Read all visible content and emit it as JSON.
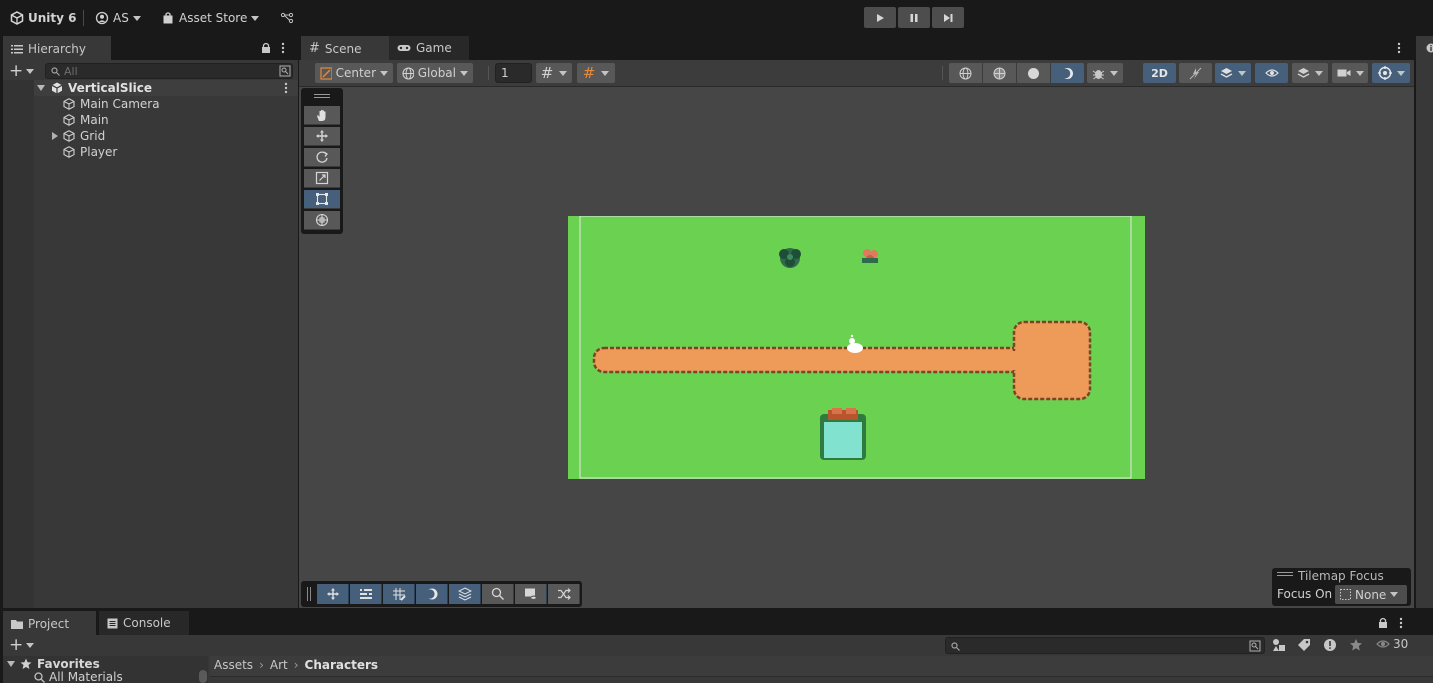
{
  "topbar": {
    "app_label": "Unity 6",
    "account_label": "AS",
    "asset_store_label": "Asset Store"
  },
  "hierarchy": {
    "tab_label": "Hierarchy",
    "search_placeholder": "All",
    "scene_name": "VerticalSlice",
    "items": [
      {
        "label": "Main Camera",
        "expandable": false
      },
      {
        "label": "Main",
        "expandable": false
      },
      {
        "label": "Grid",
        "expandable": true
      },
      {
        "label": "Player",
        "expandable": false
      }
    ]
  },
  "scene_view": {
    "tabs": [
      {
        "label": "Scene",
        "active": true
      },
      {
        "label": "Game",
        "active": false
      }
    ],
    "toolbar": {
      "pivot_mode": "Center",
      "pivot_rotation": "Global",
      "grid_snap_value": "1",
      "mode_2d_label": "2D"
    },
    "colors": {
      "ground": "#6bd251",
      "path": "#ee9a58",
      "path_edge": "#8b4f2a",
      "water": "#80e2cf",
      "selection_blue": "#46607c"
    },
    "tools": [
      "hand-tool",
      "move-tool",
      "rotate-tool",
      "scale-tool",
      "rect-tool",
      "transform-tool"
    ],
    "active_tool": "rect-tool",
    "tilemap_focus": {
      "title": "Tilemap Focus",
      "focus_on_label": "Focus On",
      "focus_value": "None"
    }
  },
  "project": {
    "tabs": [
      {
        "label": "Project",
        "active": true
      },
      {
        "label": "Console",
        "active": false
      }
    ],
    "favorites_label": "Favorites",
    "favorites_items": [
      "All Materials"
    ],
    "breadcrumb": [
      "Assets",
      "Art",
      "Characters"
    ],
    "visible_count": "30"
  }
}
